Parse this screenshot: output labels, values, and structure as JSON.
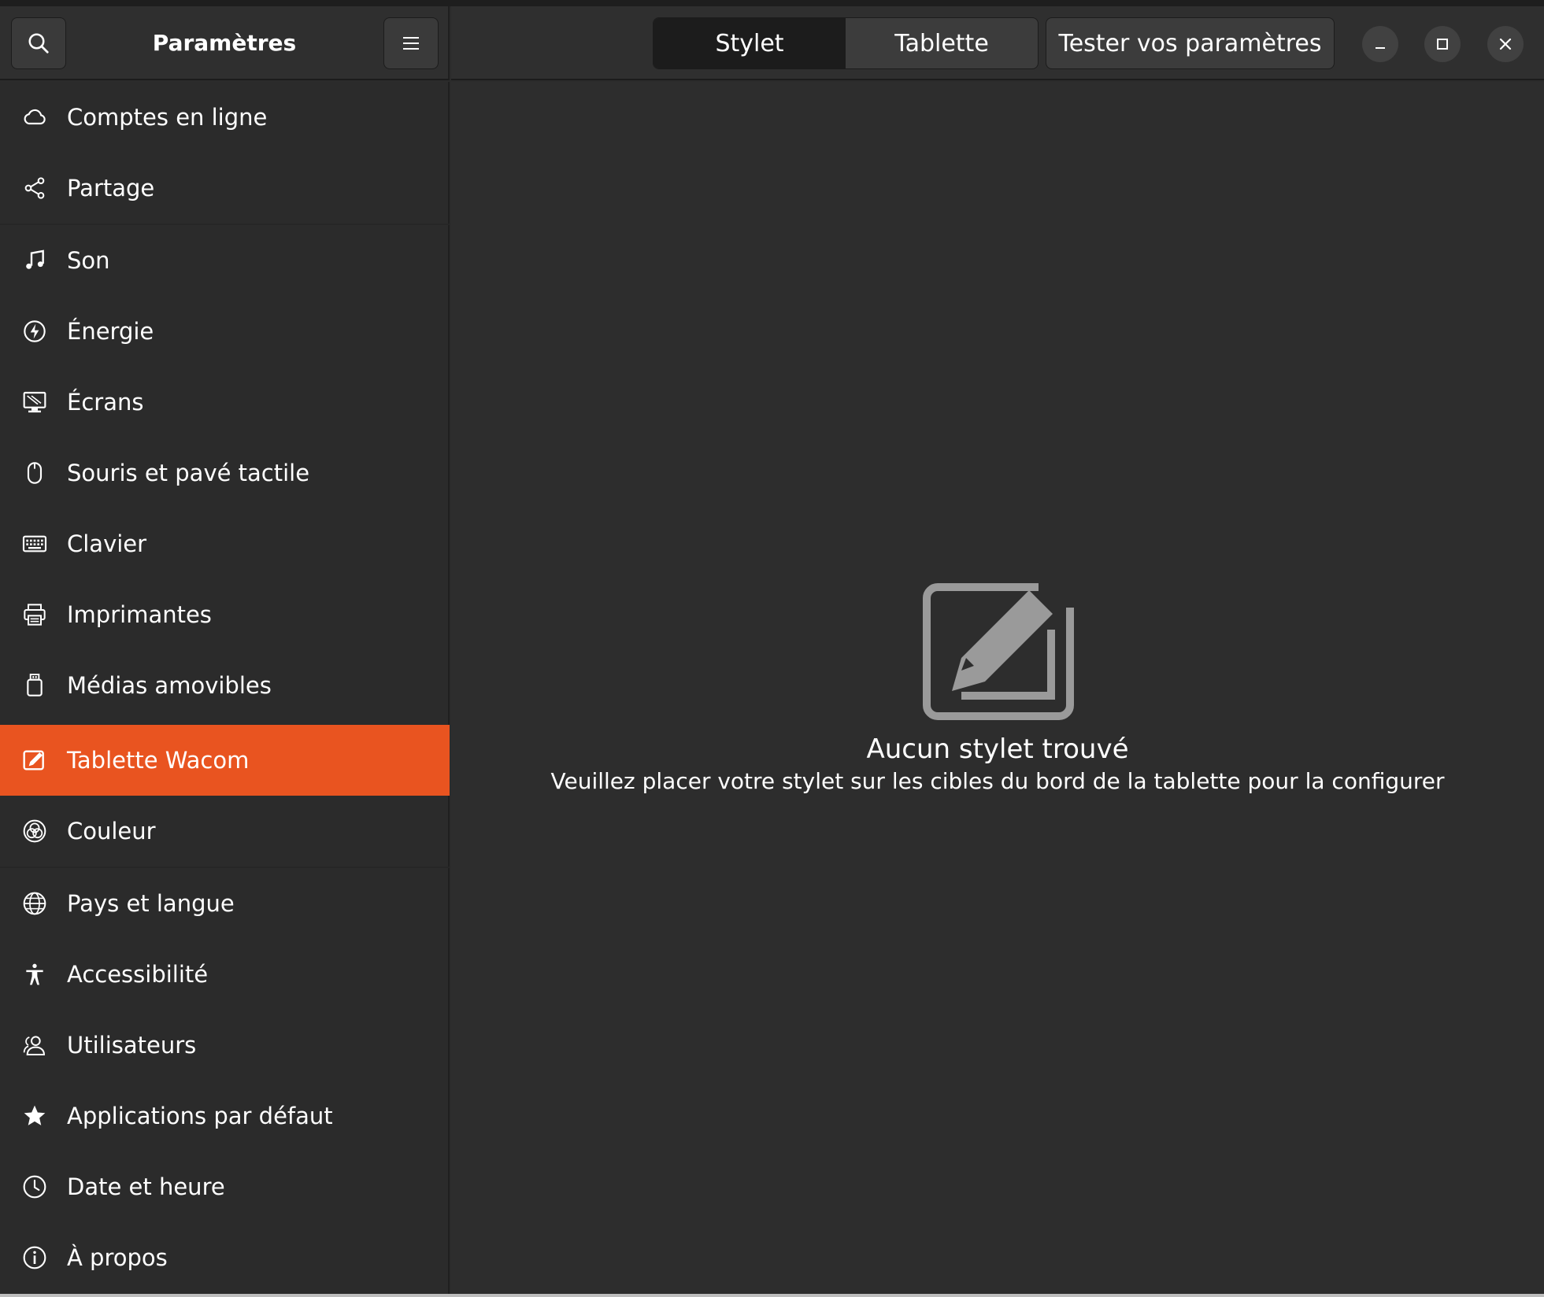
{
  "header": {
    "title": "Paramètres"
  },
  "tabs": [
    {
      "label": "Stylet",
      "active": true
    },
    {
      "label": "Tablette",
      "active": false
    }
  ],
  "test_button": "Tester vos paramètres",
  "sidebar": {
    "items": [
      {
        "label": "Comptes en ligne",
        "icon": "cloud-icon"
      },
      {
        "label": "Partage",
        "icon": "share-icon"
      },
      {
        "label": "Son",
        "icon": "music-note-icon"
      },
      {
        "label": "Énergie",
        "icon": "power-icon"
      },
      {
        "label": "Écrans",
        "icon": "display-icon"
      },
      {
        "label": "Souris et pavé tactile",
        "icon": "mouse-icon"
      },
      {
        "label": "Clavier",
        "icon": "keyboard-icon"
      },
      {
        "label": "Imprimantes",
        "icon": "printer-icon"
      },
      {
        "label": "Médias amovibles",
        "icon": "usb-drive-icon"
      },
      {
        "label": "Tablette Wacom",
        "icon": "tablet-pen-icon",
        "selected": true
      },
      {
        "label": "Couleur",
        "icon": "color-icon"
      },
      {
        "label": "Pays et langue",
        "icon": "globe-icon"
      },
      {
        "label": "Accessibilité",
        "icon": "accessibility-icon"
      },
      {
        "label": "Utilisateurs",
        "icon": "users-icon"
      },
      {
        "label": "Applications par défaut",
        "icon": "star-icon"
      },
      {
        "label": "Date et heure",
        "icon": "clock-icon"
      },
      {
        "label": "À propos",
        "icon": "info-icon"
      }
    ]
  },
  "content": {
    "empty_icon": "tablet-pen-icon",
    "title": "Aucun stylet trouvé",
    "description": "Veuillez placer votre stylet sur les cibles du bord de la tablette pour la configurer"
  },
  "colors": {
    "accent": "#e95420",
    "background": "#2d2d2d",
    "sidebar": "#2b2b2b",
    "header": "#2f2f2f"
  }
}
